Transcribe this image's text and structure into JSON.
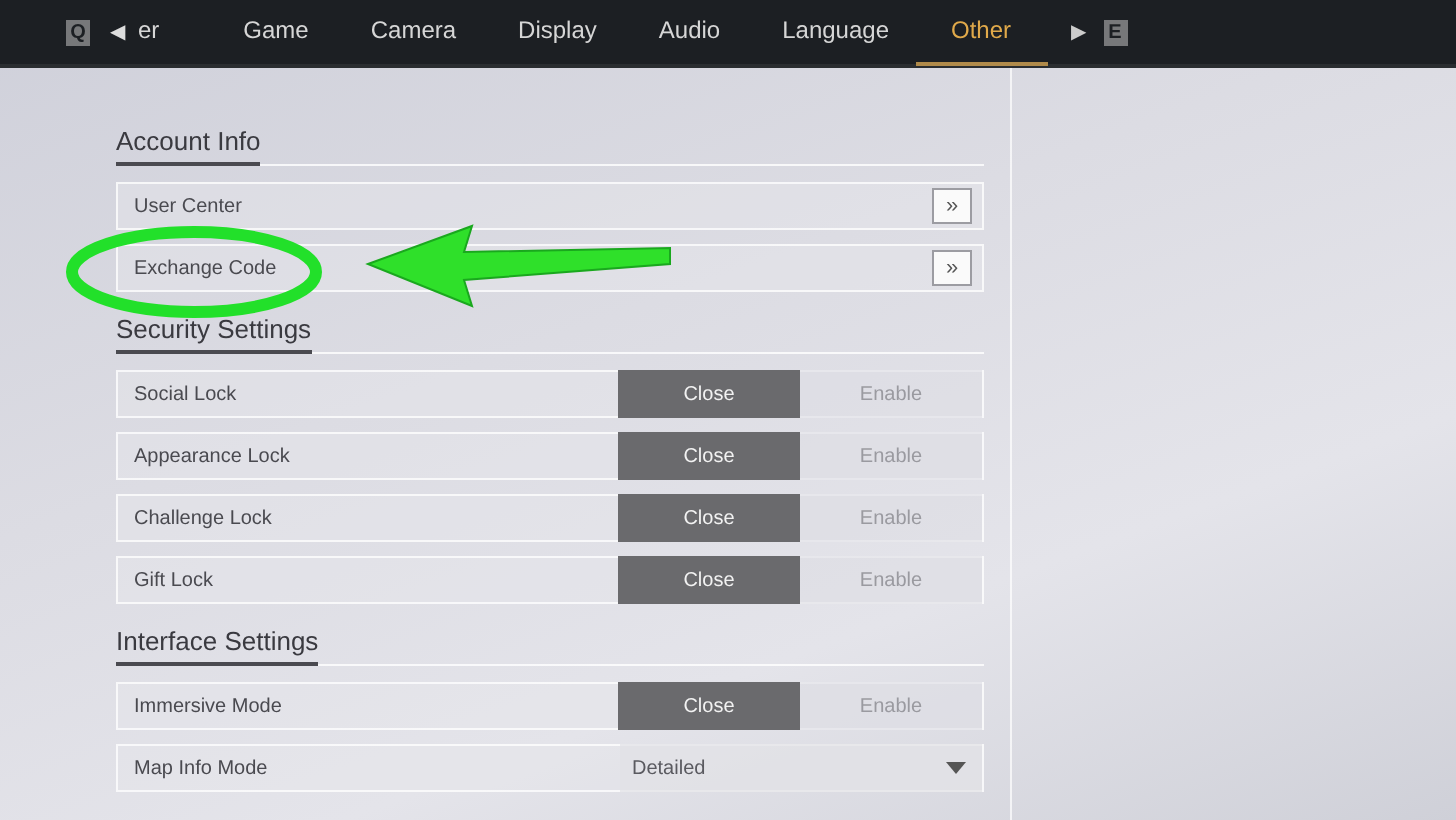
{
  "top_bar": {
    "prev_key": "Q",
    "prev_arrow": "◀",
    "next_arrow": "▶",
    "next_key": "E",
    "tabs": [
      {
        "label": "er",
        "selected": false
      },
      {
        "label": "Game",
        "selected": false
      },
      {
        "label": "Camera",
        "selected": false
      },
      {
        "label": "Display",
        "selected": false
      },
      {
        "label": "Audio",
        "selected": false
      },
      {
        "label": "Language",
        "selected": false
      },
      {
        "label": "Other",
        "selected": true
      }
    ]
  },
  "sections": [
    {
      "title": "Account Info",
      "rows": [
        {
          "kind": "link",
          "label": "User Center",
          "button": "»"
        },
        {
          "kind": "link",
          "label": "Exchange Code",
          "button": "»"
        }
      ]
    },
    {
      "title": "Security Settings",
      "rows": [
        {
          "kind": "toggle",
          "label": "Social Lock",
          "options": [
            {
              "label": "Close",
              "selected": true
            },
            {
              "label": "Enable",
              "selected": false
            }
          ]
        },
        {
          "kind": "toggle",
          "label": "Appearance Lock",
          "options": [
            {
              "label": "Close",
              "selected": true
            },
            {
              "label": "Enable",
              "selected": false
            }
          ]
        },
        {
          "kind": "toggle",
          "label": "Challenge Lock",
          "options": [
            {
              "label": "Close",
              "selected": true
            },
            {
              "label": "Enable",
              "selected": false
            }
          ]
        },
        {
          "kind": "toggle",
          "label": "Gift Lock",
          "options": [
            {
              "label": "Close",
              "selected": true
            },
            {
              "label": "Enable",
              "selected": false
            }
          ]
        }
      ]
    },
    {
      "title": "Interface Settings",
      "rows": [
        {
          "kind": "toggle",
          "label": "Immersive Mode",
          "options": [
            {
              "label": "Close",
              "selected": true
            },
            {
              "label": "Enable",
              "selected": false
            }
          ]
        },
        {
          "kind": "dropdown",
          "label": "Map Info Mode",
          "value": "Detailed"
        }
      ]
    }
  ]
}
